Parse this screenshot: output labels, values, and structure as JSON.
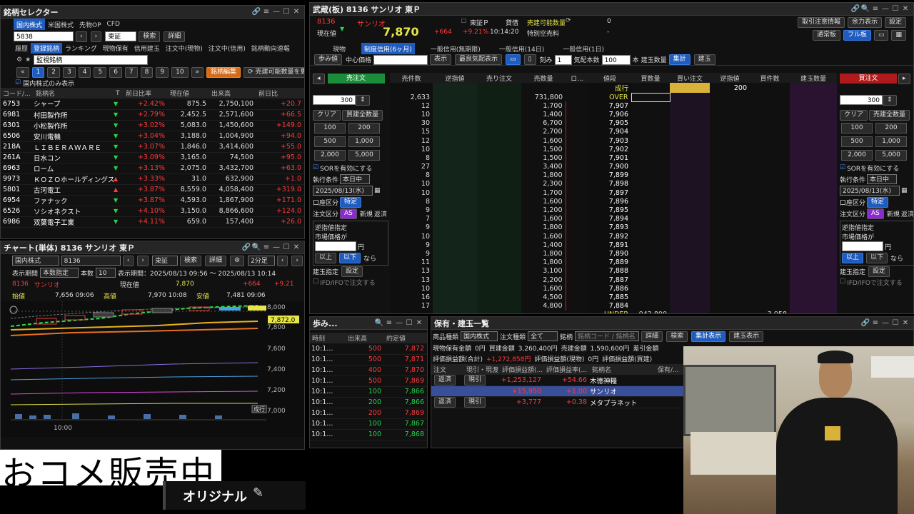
{
  "selector": {
    "title": "銘柄セレクター",
    "tabs": [
      "国内株式",
      "米国株式",
      "先物OP",
      "CFD"
    ],
    "code_value": "5838",
    "market": "東証",
    "search_label": "検索",
    "detail_label": "詳細",
    "subtabs": [
      "履歴",
      "登録銘柄",
      "ランキング",
      "現物保有",
      "信用建玉",
      "注文中(現物)",
      "注文中(信用)",
      "銘柄動向速報"
    ],
    "list_name": "監視銘柄",
    "pages": [
      "1",
      "2",
      "3",
      "4",
      "5",
      "6",
      "7",
      "8",
      "9",
      "10"
    ],
    "edit_label": "銘柄編集",
    "update_label": "売建可能数量を更新",
    "domestic_only": "国内株式のみ表示",
    "headers": [
      "コード/...",
      "銘柄名",
      "T",
      "前日比率",
      "現在値",
      "出来高",
      "前日比"
    ],
    "rows": [
      {
        "code": "6753",
        "name": "シャープ",
        "trend": "▼",
        "rate": "+2.42%",
        "price": "875.5",
        "volume": "2,750,100",
        "change": "+20.7"
      },
      {
        "code": "6981",
        "name": "村田製作所",
        "trend": "▼",
        "rate": "+2.79%",
        "price": "2,452.5",
        "volume": "2,571,600",
        "change": "+66.5"
      },
      {
        "code": "6301",
        "name": "小松製作所",
        "trend": "▼",
        "rate": "+3.02%",
        "price": "5,083.0",
        "volume": "1,450,600",
        "change": "+149.0"
      },
      {
        "code": "6506",
        "name": "安川電機",
        "trend": "▼",
        "rate": "+3.04%",
        "price": "3,188.0",
        "volume": "1,004,900",
        "change": "+94.0"
      },
      {
        "code": "218A",
        "name": "ＬＩＢＥＲＡＷＡＲＥ",
        "trend": "▼",
        "rate": "+3.07%",
        "price": "1,846.0",
        "volume": "3,414,600",
        "change": "+55.0"
      },
      {
        "code": "261A",
        "name": "日水コン",
        "trend": "▼",
        "rate": "+3.09%",
        "price": "3,165.0",
        "volume": "74,500",
        "change": "+95.0"
      },
      {
        "code": "6963",
        "name": "ローム",
        "trend": "▼",
        "rate": "+3.13%",
        "price": "2,075.0",
        "volume": "3,432,700",
        "change": "+63.0"
      },
      {
        "code": "9973",
        "name": "ＫＯＺＯホールディングス",
        "trend": "▲",
        "rate": "+3.33%",
        "price": "31.0",
        "volume": "632,900",
        "change": "+1.0"
      },
      {
        "code": "5801",
        "name": "古河電工",
        "trend": "▲",
        "rate": "+3.87%",
        "price": "8,559.0",
        "volume": "4,058,400",
        "change": "+319.0"
      },
      {
        "code": "6954",
        "name": "ファナック",
        "trend": "▼",
        "rate": "+3.87%",
        "price": "4,593.0",
        "volume": "1,867,900",
        "change": "+171.0"
      },
      {
        "code": "6526",
        "name": "ソシオネクスト",
        "trend": "▼",
        "rate": "+4.10%",
        "price": "3,150.0",
        "volume": "8,866,600",
        "change": "+124.0"
      },
      {
        "code": "6986",
        "name": "双葉電子工業",
        "trend": "▼",
        "rate": "+4.11%",
        "price": "659.0",
        "volume": "157,400",
        "change": "+26.0"
      }
    ]
  },
  "chart": {
    "title": "チャート(単体) 8136 サンリオ 東Ｐ",
    "market_type": "国内株式",
    "code": "8136",
    "exchange": "東証",
    "search_label": "検索",
    "detail_label": "詳細",
    "interval": "2分足",
    "period_label": "表示期間",
    "period_mode": "本数指定",
    "count_label": "本数",
    "count_value": "10",
    "range_text": "表示期間：2025/08/13 09:56 ～ 2025/08/13 10:14",
    "stock_code": "8136",
    "stock_name": "サンリオ",
    "price_label": "現在値",
    "price": "7,870",
    "change": "+664",
    "change_pct": "+9.21",
    "open_label": "始値",
    "open": "7,656 09:06",
    "high_label": "高値",
    "high": "7,970 10:08",
    "low_label": "安値",
    "low": "7,481 09:06",
    "y_ticks": [
      "8,000",
      "7,800",
      "7,600",
      "7,400",
      "7,200",
      "7,000"
    ],
    "last_tag": "7,872.0",
    "x_tick": "10:00",
    "order_tag": "成行"
  },
  "board": {
    "title": "武蔵(板) 8136 サンリオ 東Ｐ",
    "code": "8136",
    "name": "サンリオ",
    "current_label": "現在値",
    "price": "7,870",
    "change": "+664",
    "change_pct": "+9.21%",
    "time": "10:14:20",
    "market": "東証Ｐ",
    "loan": "貸借",
    "sellable_label": "売建可能数量",
    "sellable_value": "0",
    "special_label": "特別空売料",
    "special_value": "-",
    "right_buttons": [
      "取引注意情報",
      "余力表示",
      "設定"
    ],
    "mode_buttons": [
      "通常板",
      "フル板"
    ],
    "tabs": [
      "現物",
      "制度信用(6ヶ月)",
      "一般信用(無期限)",
      "一般信用(14日)",
      "一般信用(1日)"
    ],
    "toolbar": {
      "step": "歩み値",
      "center": "中心価格",
      "show": "表示",
      "best": "最良気配表示",
      "tick": "刻み",
      "tick_value": "1",
      "qty_label": "気配本数",
      "qty_value": "100",
      "unit": "本",
      "kenn": "建玉数量",
      "total": "集計",
      "build": "建玉"
    },
    "sell_order": "売注文",
    "buy_order": "買注文",
    "headers": [
      "売件数",
      "逆指値",
      "売り注文",
      "売数量",
      "ロ...",
      "値段",
      "買数量",
      "買い注文",
      "逆指値",
      "買件数",
      "建玉数量"
    ],
    "market_row": {
      "label": "成行",
      "buy_qty": "200"
    },
    "over_row": {
      "count": "2,633",
      "qty": "731,800",
      "label": "OVER"
    },
    "levels": [
      {
        "count": "12",
        "qty": "1,700",
        "price": "7,907"
      },
      {
        "count": "10",
        "qty": "1,400",
        "price": "7,906"
      },
      {
        "count": "30",
        "qty": "6,700",
        "price": "7,905"
      },
      {
        "count": "15",
        "qty": "2,700",
        "price": "7,904"
      },
      {
        "count": "12",
        "qty": "1,600",
        "price": "7,903"
      },
      {
        "count": "10",
        "qty": "1,500",
        "price": "7,902"
      },
      {
        "count": "8",
        "qty": "1,500",
        "price": "7,901"
      },
      {
        "count": "27",
        "qty": "3,400",
        "price": "7,900"
      },
      {
        "count": "8",
        "qty": "1,800",
        "price": "7,899"
      },
      {
        "count": "10",
        "qty": "2,300",
        "price": "7,898"
      },
      {
        "count": "10",
        "qty": "1,700",
        "price": "7,897"
      },
      {
        "count": "8",
        "qty": "1,600",
        "price": "7,896"
      },
      {
        "count": "9",
        "qty": "1,200",
        "price": "7,895"
      },
      {
        "count": "7",
        "qty": "1,600",
        "price": "7,894"
      },
      {
        "count": "9",
        "qty": "1,800",
        "price": "7,893"
      },
      {
        "count": "10",
        "qty": "1,600",
        "price": "7,892"
      },
      {
        "count": "9",
        "qty": "1,400",
        "price": "7,891"
      },
      {
        "count": "9",
        "qty": "1,800",
        "price": "7,890"
      },
      {
        "count": "11",
        "qty": "1,800",
        "price": "7,889"
      },
      {
        "count": "13",
        "qty": "3,100",
        "price": "7,888"
      },
      {
        "count": "13",
        "qty": "2,200",
        "price": "7,887"
      },
      {
        "count": "10",
        "qty": "1,600",
        "price": "7,886"
      },
      {
        "count": "16",
        "qty": "4,500",
        "price": "7,885"
      },
      {
        "count": "17",
        "qty": "4,800",
        "price": "7,884"
      }
    ],
    "under_row": {
      "label": "UNDER",
      "qty": "942,800",
      "count": "3,958"
    },
    "side": {
      "qty": "300",
      "clear": "クリア",
      "all": "買建全数量",
      "all_sell": "売建全数量",
      "amounts": [
        "100",
        "200",
        "500",
        "1,000",
        "2,000",
        "5,000"
      ],
      "sor": "SORを有効にする",
      "cond_label": "執行条件",
      "cond_value": "本日中",
      "date": "2025/08/13(水)",
      "account_label": "口座区分",
      "account_value": "特定",
      "order_label": "注文区分",
      "as": "AS",
      "new": "新規",
      "close": "返済",
      "stop": "逆指値指定",
      "market_price": "市場価格が",
      "yen": "円",
      "above": "以上",
      "below": "以下",
      "then": "なら",
      "position": "建玉指定",
      "set": "設定",
      "ifd": "IFD/IFOで注文する"
    }
  },
  "ticks": {
    "title": "歩み...",
    "headers": [
      "時刻",
      "出来高",
      "約定値"
    ],
    "rows": [
      {
        "time": "10:1...",
        "vol": "500",
        "price": "7,872",
        "up": false
      },
      {
        "time": "10:1...",
        "vol": "500",
        "price": "7,871",
        "up": false
      },
      {
        "time": "10:1...",
        "vol": "400",
        "price": "7,870",
        "up": false
      },
      {
        "time": "10:1...",
        "vol": "500",
        "price": "7,869",
        "up": false
      },
      {
        "time": "10:1...",
        "vol": "100",
        "price": "7,866",
        "up": true
      },
      {
        "time": "10:1...",
        "vol": "200",
        "price": "7,866",
        "up": true
      },
      {
        "time": "10:1...",
        "vol": "200",
        "price": "7,869",
        "up": false
      },
      {
        "time": "10:1...",
        "vol": "100",
        "price": "7,867",
        "up": true
      },
      {
        "time": "10:1...",
        "vol": "100",
        "price": "7,868",
        "up": true
      }
    ]
  },
  "holdings": {
    "title": "保有・建玉一覧",
    "type_label": "商品種類",
    "type_value": "国内株式",
    "order_type_label": "注文種類",
    "order_type_value": "全て",
    "stock_label": "銘柄",
    "stock_placeholder": "銘柄コード / 銘柄名",
    "detail": "詳細",
    "search": "検索",
    "summary": "集計表示",
    "build": "建玉表示",
    "cash_label": "現物保有金額",
    "cash": "0円",
    "buy_label": "買建金額",
    "buy": "3,260,400円",
    "sell_label": "売建金額",
    "sell": "1,590,600円",
    "diff_label": "差引金額",
    "pl_total_label": "評価損益額(合計)",
    "pl_total": "+1,272,858円",
    "pl_cash_label": "評価損益額(現物)",
    "pl_cash": "0円",
    "pl_credit_label": "評価損益額(買建)",
    "headers": [
      "注文",
      "現引・現渡",
      "評価損益額(...",
      "評価損益率(...",
      "銘柄名",
      "保有/..."
    ],
    "rows": [
      {
        "order": "返済",
        "deliver": "現引",
        "pl": "+1,253,127",
        "rate": "+54.66",
        "name": "木徳神糧",
        "sel": false
      },
      {
        "order": "",
        "deliver": "",
        "pl": "+15,950",
        "rate": "+1.00",
        "name": "サンリオ",
        "sel": true
      },
      {
        "order": "返済",
        "deliver": "現引",
        "pl": "+3,777",
        "rate": "+0.38",
        "name": "メタプラネット",
        "sel": false
      }
    ]
  },
  "overlay": {
    "caption": "おコメ販売中",
    "original": "オリジナル"
  }
}
